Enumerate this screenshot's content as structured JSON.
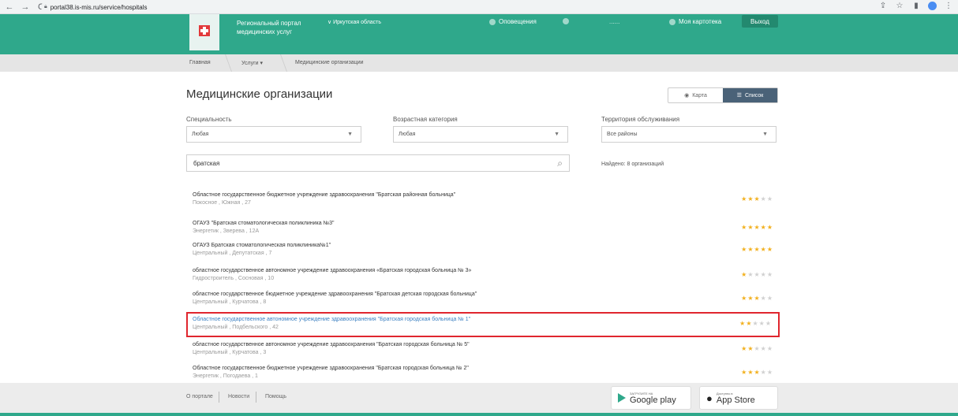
{
  "browser": {
    "url": "portal38.is-mis.ru/service/hospitals"
  },
  "header": {
    "portal_title": "Региональный портал медицинских услуг",
    "region": "∨ Иркутская область",
    "notifications": "Оповещения",
    "user_name": "......",
    "cabinet": "Моя картотека",
    "logout": "Выход"
  },
  "breadcrumb": {
    "home": "Главная",
    "services": "Услуги ▾",
    "current": "Медицинские организации"
  },
  "main": {
    "title": "Медицинские организации",
    "view_map": "Карта",
    "view_list": "Список",
    "filters": {
      "specialty_label": "Специальность",
      "specialty_value": "Любая",
      "age_label": "Возрастная категория",
      "age_value": "Любая",
      "territory_label": "Территория обслуживания",
      "territory_value": "Все районы"
    },
    "search_value": "братская",
    "found": "Найдено: 8 организаций"
  },
  "organizations": [
    {
      "name": "Областное государственное бюджетное учреждение здравоохранения \"Братская районная больница\"",
      "address": "Покосное , Южная , 27",
      "rating": 3
    },
    {
      "name": "ОГАУЗ \"Братская стоматологическая поликлиника №3\"",
      "address": "Энергетик , Зверева , 12А",
      "rating": 5
    },
    {
      "name": "ОГАУЗ Братская стоматологическая поликлиника№1\"",
      "address": "Центральный , Депутатская , 7",
      "rating": 5
    },
    {
      "name": "областное государственное автономное учреждение здравоохранения «Братская городская больница № 3»",
      "address": "Гидростроитель , Сосновая , 10",
      "rating": 1
    },
    {
      "name": "областное государственное бюджетное учреждение здравоохранения \"Братская детская городская больница\"",
      "address": "Центральный , Курчатова , 8",
      "rating": 3
    },
    {
      "name": "Областное государственное автономное учреждение здравоохранения \"Братская городская больница № 1\"",
      "address": "Центральный , Подбельского , 42",
      "rating": 2
    },
    {
      "name": "областное государственное автономное учреждение здравоохранения \"Братская городская больница № 5\"",
      "address": "Центральный , Курчатова , 3",
      "rating": 2
    },
    {
      "name": "Областное государственное бюджетное учреждение здравоохранения \"Братская городская больница № 2\"",
      "address": "Энергетик , Погодаева , 1",
      "rating": 3
    }
  ],
  "footer": {
    "about": "О портале",
    "news": "Новости",
    "help": "Помощь",
    "google_small": "ЗАГРУЗИТЕ НА",
    "google_big": "Google play",
    "apple_small": "Доступно в",
    "apple_big": "App Store"
  },
  "colors": {
    "header": "#2fa88b",
    "highlight_border": "#e0262e",
    "star": "#f2b01e"
  }
}
